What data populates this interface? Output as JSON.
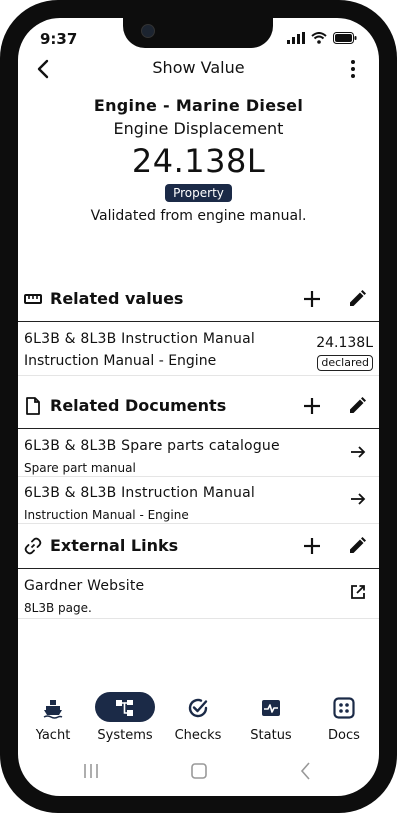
{
  "status_bar": {
    "time": "9:37"
  },
  "top_bar": {
    "title": "Show Value"
  },
  "hero": {
    "subject": "Engine - Marine Diesel",
    "name": "Engine Displacement",
    "value": "24.138L",
    "badge": "Property",
    "note": "Validated from engine manual."
  },
  "related_values": {
    "title": "Related values",
    "items": [
      {
        "title": "6L3B & 8L3B Instruction Manual",
        "subtitle": "Instruction Manual - Engine",
        "value": "24.138L",
        "tag": "declared"
      }
    ]
  },
  "related_documents": {
    "title": "Related Documents",
    "items": [
      {
        "title": "6L3B & 8L3B Spare parts catalogue",
        "subtitle": "Spare part manual"
      },
      {
        "title": "6L3B & 8L3B Instruction Manual",
        "subtitle": "Instruction Manual - Engine"
      }
    ]
  },
  "external_links": {
    "title": "External Links",
    "items": [
      {
        "title": "Gardner Website",
        "subtitle": "8L3B page."
      }
    ]
  },
  "bottom_nav": {
    "items": [
      {
        "label": "Yacht",
        "icon": "ship-icon",
        "active": false
      },
      {
        "label": "Systems",
        "icon": "systems-icon",
        "active": true
      },
      {
        "label": "Checks",
        "icon": "check-circle-icon",
        "active": false
      },
      {
        "label": "Status",
        "icon": "pulse-icon",
        "active": false
      },
      {
        "label": "Docs",
        "icon": "docs-grid-icon",
        "active": false
      }
    ]
  },
  "colors": {
    "accent": "#1b2a47",
    "frame": "#0d0d0d"
  }
}
